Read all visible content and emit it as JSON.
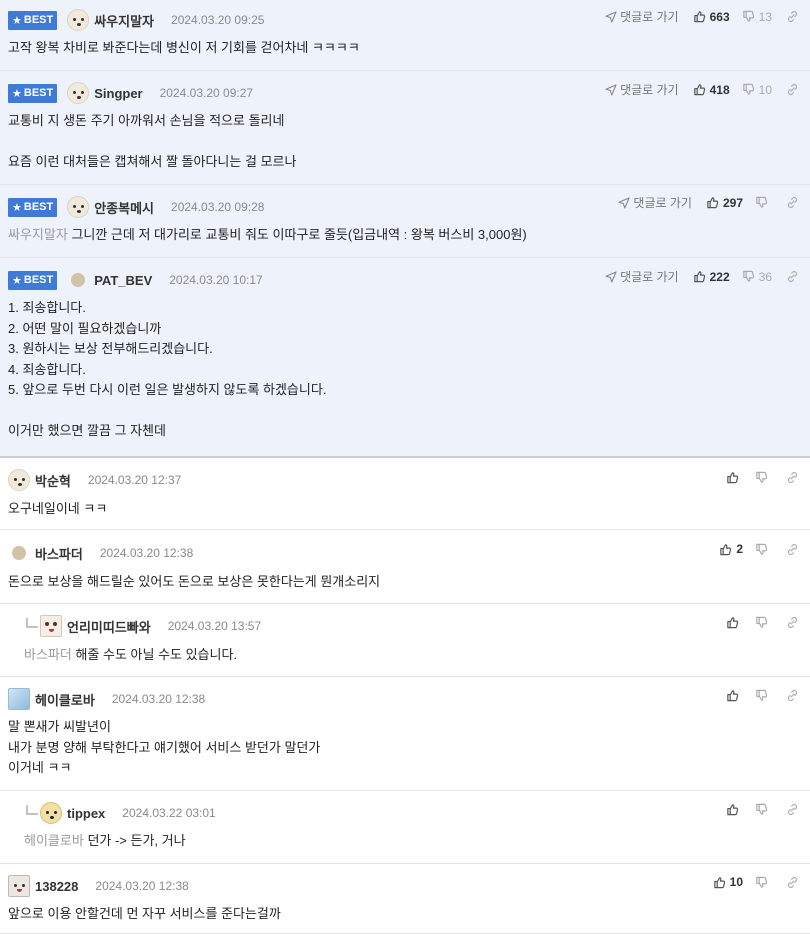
{
  "labels": {
    "best": "BEST",
    "goto_comment": "댓글로 가기"
  },
  "colors": {
    "best_badge": "#3e7ad6",
    "best_background": "#eef3fb",
    "mention": "#9a9a9a"
  },
  "icons": {
    "star": "★",
    "thumb_up": "thumb-up-icon",
    "thumb_down": "thumb-down-icon",
    "link": "link-icon",
    "arrow": "send-arrow-icon"
  },
  "comments": [
    {
      "best": true,
      "reply": false,
      "avatar": "dog",
      "nick": "싸우지말자",
      "date": "2024.03.20 09:25",
      "up": "663",
      "down": "13",
      "mention": "",
      "body": "고작 왕복 차비로 봐준다는데 병신이 저 기회를 걷어차네 ㅋㅋㅋㅋ"
    },
    {
      "best": true,
      "reply": false,
      "avatar": "dog",
      "nick": "Singper",
      "date": "2024.03.20 09:27",
      "up": "418",
      "down": "10",
      "mention": "",
      "body": "교통비 지 생돈 주기 아까워서 손님을 적으로 돌리네\n\n요즘 이런 대처들은 캡쳐해서 짤 돌아다니는 걸 모르나"
    },
    {
      "best": true,
      "reply": false,
      "avatar": "dog",
      "nick": "안종복메시",
      "date": "2024.03.20 09:28",
      "up": "297",
      "down": "",
      "mention": "싸우지말자",
      "body": "그니깐 근데 저 대가리로 교통비 줘도 이따구로 줄듯(입금내역 : 왕복 버스비 3,000원)"
    },
    {
      "best": true,
      "reply": false,
      "avatar": "dot",
      "nick": "PAT_BEV",
      "date": "2024.03.20 10:17",
      "up": "222",
      "down": "36",
      "mention": "",
      "body": "1. 죄송합니다.\n2. 어떤 말이 필요하겠습니까\n3. 원하시는 보상 전부해드리겠습니다.\n4. 죄송합니다.\n5. 앞으로 두번 다시 이런 일은 발생하지 않도록 하겠습니다.\n\n이거만 했으면 깔끔 그 자첸데"
    },
    {
      "best": false,
      "reply": false,
      "avatar": "dog",
      "nick": "박순혁",
      "date": "2024.03.20 12:37",
      "up": "",
      "down": "",
      "mention": "",
      "body": "오구네일이네 ㅋㅋ"
    },
    {
      "best": false,
      "reply": false,
      "avatar": "dot",
      "nick": "바스파더",
      "date": "2024.03.20 12:38",
      "up": "2",
      "down": "",
      "mention": "",
      "body": "돈으로 보상을 해드릴순 있어도 돈으로 보상은 못한다는게 뭔개소리지"
    },
    {
      "best": false,
      "reply": true,
      "avatar": "face",
      "nick": "언리미띠드빠와",
      "date": "2024.03.20 13:57",
      "up": "",
      "down": "",
      "mention": "바스파더",
      "body": "해줄 수도 아닐 수도 있습니다."
    },
    {
      "best": false,
      "reply": false,
      "avatar": "blue",
      "nick": "헤이클로바",
      "date": "2024.03.20 12:38",
      "up": "",
      "down": "",
      "mention": "",
      "body": "말 뽄새가 씨발년이\n내가 분명 양해 부탁한다고 얘기했어 서비스 받던가 말던가\n이거네 ㅋㅋ"
    },
    {
      "best": false,
      "reply": true,
      "avatar": "fox",
      "nick": "tippex",
      "date": "2024.03.22 03:01",
      "up": "",
      "down": "",
      "mention": "헤이클로바",
      "body": "던가 -> 든가, 거나"
    },
    {
      "best": false,
      "reply": false,
      "avatar": "sheep",
      "nick": "138228",
      "date": "2024.03.20 12:38",
      "up": "10",
      "down": "",
      "mention": "",
      "body": "앞으로 이용 안할건데 먼 자꾸 서비스를 준다는걸까"
    }
  ]
}
